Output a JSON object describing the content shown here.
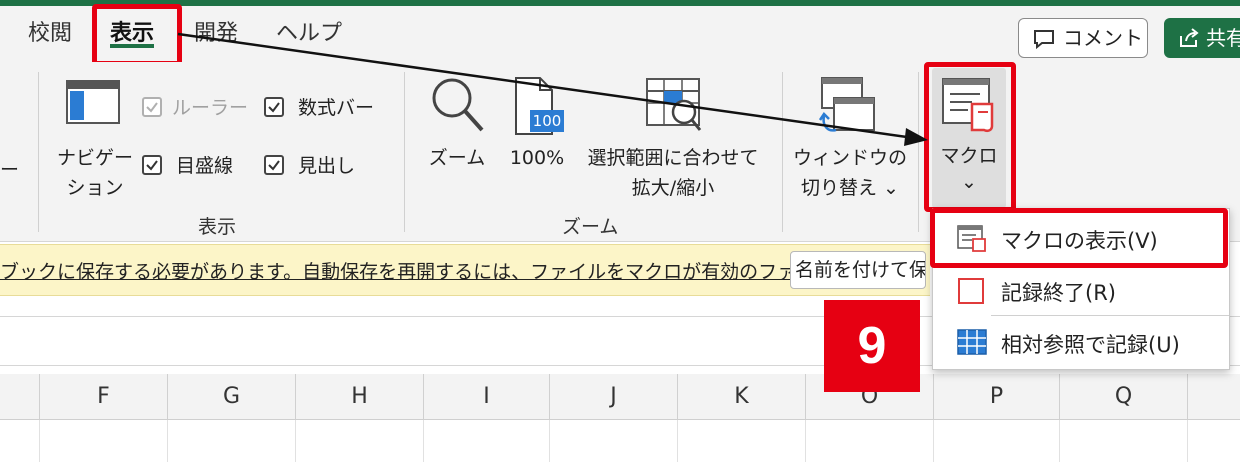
{
  "tabs": [
    {
      "label": "校閲",
      "active": false
    },
    {
      "label": "表示",
      "active": true
    },
    {
      "label": "開発",
      "active": false
    },
    {
      "label": "ヘルプ",
      "active": false
    }
  ],
  "header_buttons": {
    "comment": "コメント",
    "share": "共有"
  },
  "ribbon": {
    "left_partial": "ー",
    "navigation": {
      "line1": "ナビゲー",
      "line2": "ション"
    },
    "checkboxes": {
      "ruler": {
        "label": "ルーラー",
        "checked": true,
        "enabled": false
      },
      "formula_bar": {
        "label": "数式バー",
        "checked": true,
        "enabled": true
      },
      "gridlines": {
        "label": "目盛線",
        "checked": true,
        "enabled": true
      },
      "headings": {
        "label": "見出し",
        "checked": true,
        "enabled": true
      }
    },
    "group_show": "表示",
    "zoom": {
      "label": "ズーム",
      "icon_text": "100"
    },
    "zoom100": "100%",
    "zoom_selection": {
      "line1": "選択範囲に合わせて",
      "line2": "拡大/縮小"
    },
    "group_zoom": "ズーム",
    "switch_windows": {
      "line1": "ウィンドウの",
      "line2": "切り替え ⌄"
    },
    "macro": {
      "label": "マクロ",
      "chevron": "⌄"
    }
  },
  "message_bar": {
    "text": "ブックに保存する必要があります。自動保存を再開するには、ファイルをマクロが有効のファイルに",
    "button": "名前を付けて保存..."
  },
  "columns": [
    "F",
    "G",
    "H",
    "I",
    "J",
    "K",
    "O",
    "P",
    "Q"
  ],
  "dropdown": {
    "items": [
      {
        "label": "マクロの表示(V)",
        "icon": "macro-view-icon"
      },
      {
        "label": "記録終了(R)",
        "icon": "stop-recording-icon"
      },
      {
        "label": "相対参照で記録(U)",
        "icon": "relative-reference-icon"
      }
    ]
  },
  "step_badge": "9",
  "colors": {
    "excel_green": "#1e7145",
    "highlight_red": "#e60012",
    "message_yellow": "#fcf5c8",
    "ribbon_bg": "#f3f3f3"
  }
}
